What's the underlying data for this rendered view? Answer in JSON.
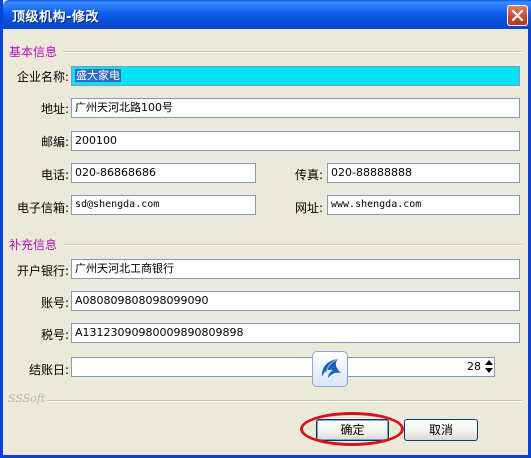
{
  "window": {
    "title": "顶级机构-修改"
  },
  "sections": {
    "basic": "基本信息",
    "extra": "补充信息"
  },
  "fields": {
    "company_name": {
      "label": "企业名称:",
      "value": "盛大家电"
    },
    "address": {
      "label": "地址:",
      "value": "广州天河北路100号"
    },
    "postcode": {
      "label": "邮编:",
      "value": "200100"
    },
    "phone": {
      "label": "电话:",
      "value": "020-86868686"
    },
    "fax": {
      "label": "传真:",
      "value": "020-88888888"
    },
    "email": {
      "label": "电子信箱:",
      "value": "sd@shengda.com"
    },
    "website": {
      "label": "网址:",
      "value": "www.shengda.com"
    },
    "bank": {
      "label": "开户银行:",
      "value": "广州天河北工商银行"
    },
    "account": {
      "label": "账号:",
      "value": "A080809808098099090"
    },
    "tax_id": {
      "label": "税号:",
      "value": "A1312309098000989080989​8"
    },
    "closing_day": {
      "label": "结账日:",
      "value": "28"
    }
  },
  "watermark": "SSSoft",
  "buttons": {
    "ok": "确定",
    "cancel": "取消"
  },
  "colors": {
    "title_bar": "#0A5AE8",
    "section_title": "#B010B8",
    "highlight_field": "#00E4F4",
    "annotation": "#D3151B"
  },
  "icons": {
    "close": "close-icon",
    "floating": "swallow-logo-icon"
  }
}
